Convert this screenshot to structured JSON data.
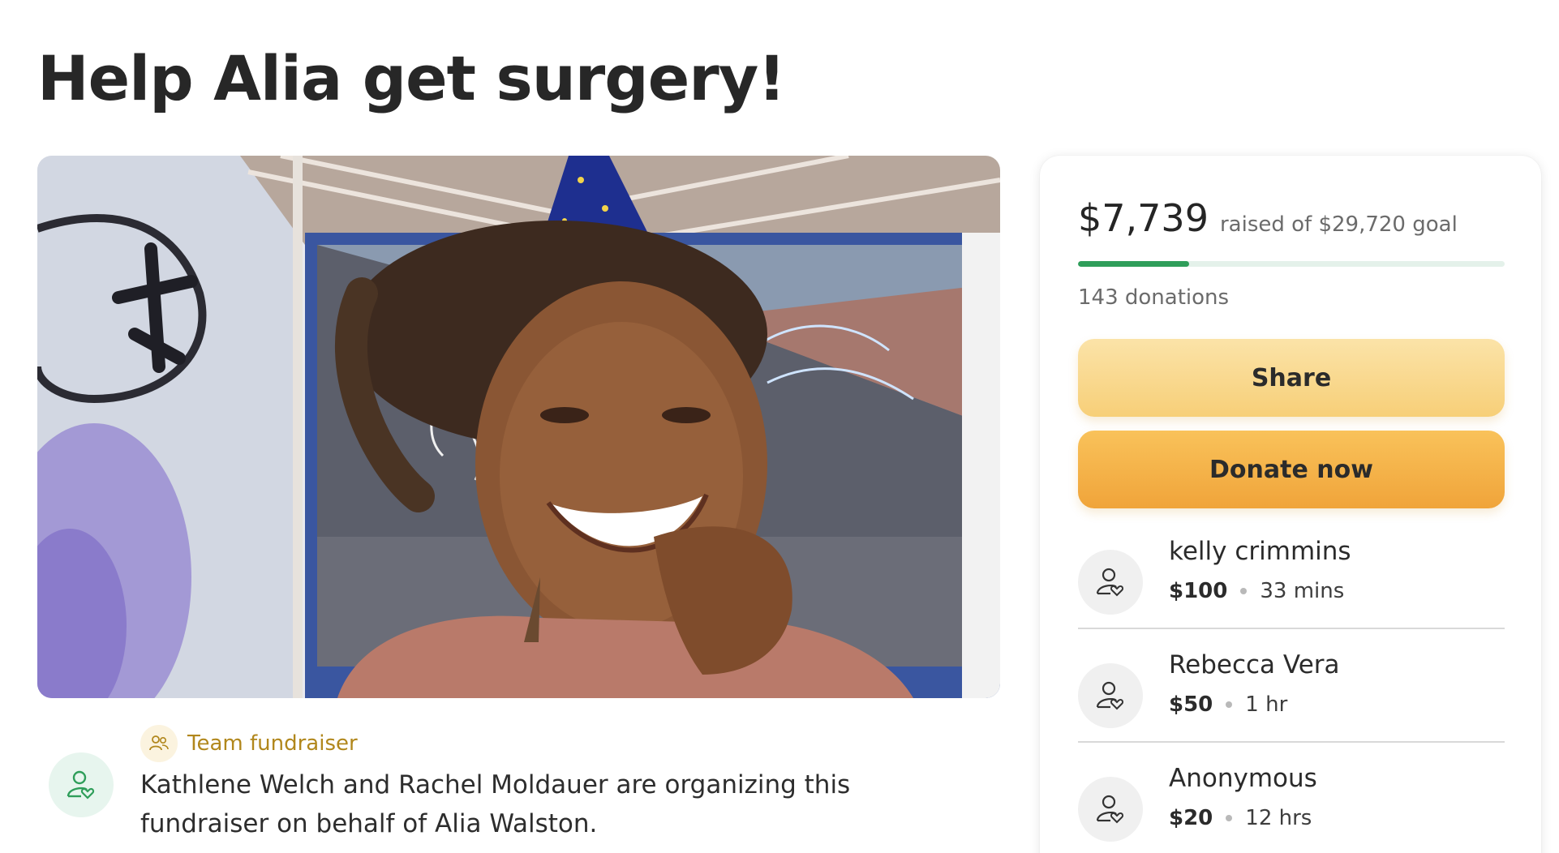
{
  "page": {
    "title": "Help Alia get surgery!"
  },
  "hero": {
    "icon": "fundraiser-photo"
  },
  "organizer": {
    "team_label": "Team fundraiser",
    "description": "Kathlene Welch and Rachel Moldauer are organizing this fundraiser on behalf of Alia Walston."
  },
  "donation_card": {
    "raised_amount": "$7,739",
    "goal_text": "raised of $29,720 goal",
    "progress_fraction": 0.26,
    "donations_count": "143 donations",
    "share_label": "Share",
    "donate_label": "Donate now",
    "donors": [
      {
        "name": "kelly crimmins",
        "amount": "$100",
        "time": "33 mins"
      },
      {
        "name": "Rebecca Vera",
        "amount": "$50",
        "time": "1 hr"
      },
      {
        "name": "Anonymous",
        "amount": "$20",
        "time": "12 hrs"
      }
    ]
  },
  "colors": {
    "progress": "#2f9e5a",
    "share_button": "#f7cf78",
    "donate_button": "#f0a43a",
    "team_label": "#b1871c"
  }
}
